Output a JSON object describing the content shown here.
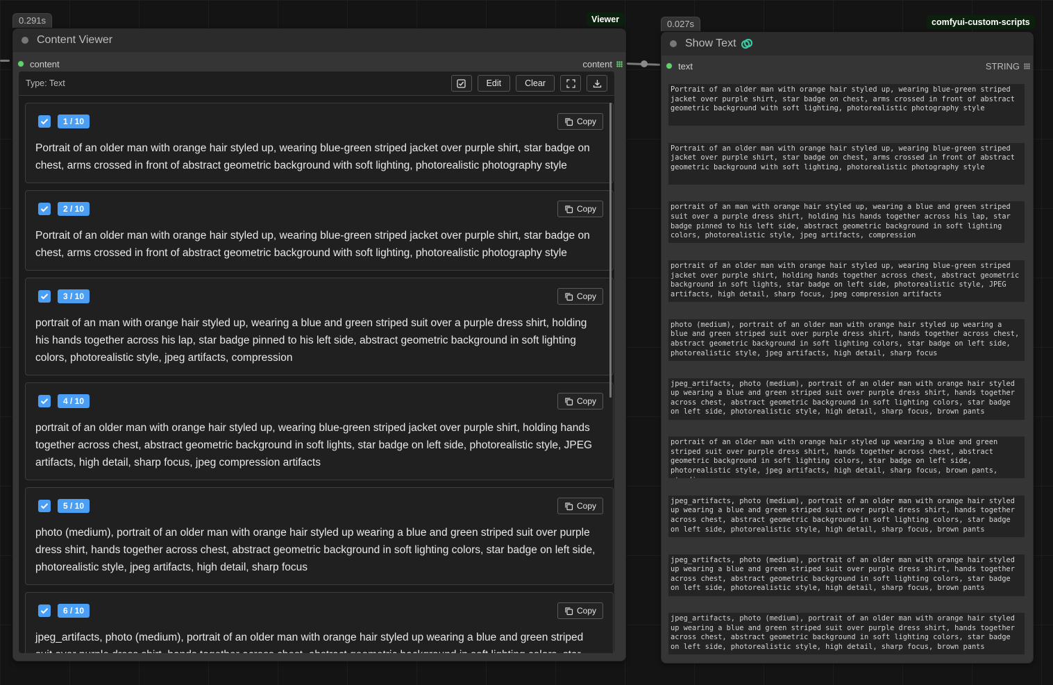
{
  "viewer": {
    "time": "0.291s",
    "tag": "Viewer",
    "title": "Content Viewer",
    "input_label": "content",
    "output_label": "content",
    "type_label": "Type: Text",
    "edit_label": "Edit",
    "clear_label": "Clear",
    "copy_label": "Copy",
    "items": [
      {
        "index": "1 / 10",
        "text": "Portrait of an older man with orange hair styled up, wearing blue-green striped jacket over purple shirt, star badge on chest, arms crossed in front of abstract geometric background with soft lighting, photorealistic photography style"
      },
      {
        "index": "2 / 10",
        "text": "Portrait of an older man with orange hair styled up, wearing blue-green striped jacket over purple shirt, star badge on chest, arms crossed in front of abstract geometric background with soft lighting, photorealistic photography style"
      },
      {
        "index": "3 / 10",
        "text": "portrait of an man with orange hair styled up, wearing a blue and green striped suit over a purple dress shirt, holding his hands together across his lap, star badge pinned to his left side, abstract geometric background in soft lighting colors, photorealistic style, jpeg artifacts, compression"
      },
      {
        "index": "4 / 10",
        "text": "portrait of an older man with orange hair styled up, wearing blue-green striped jacket over purple shirt, holding hands together across chest, abstract geometric background in soft lights, star badge on left side, photorealistic style, JPEG artifacts, high detail, sharp focus, jpeg compression artifacts"
      },
      {
        "index": "5 / 10",
        "text": "photo (medium), portrait of an older man with orange hair styled up wearing a blue and green striped suit over purple dress shirt, hands together across chest, abstract geometric background in soft lighting colors, star badge on left side, photorealistic style, jpeg artifacts, high detail, sharp focus"
      },
      {
        "index": "6 / 10",
        "text": "jpeg_artifacts, photo (medium), portrait of an older man with orange hair styled up wearing a blue and green striped suit over purple dress shirt, hands together across chest, abstract geometric background in soft lighting colors, star badge on left side, photorealistic style, high detail, sharp focus, brown pants"
      }
    ]
  },
  "showtext": {
    "time": "0.027s",
    "tag": "comfyui-custom-scripts",
    "title": "Show Text",
    "input_label": "text",
    "output_label": "STRING",
    "texts": [
      "Portrait of an older man with orange hair styled up, wearing blue-green striped jacket over purple shirt, star badge on chest, arms crossed in front of abstract geometric background with soft lighting, photorealistic photography style",
      "Portrait of an older man with orange hair styled up, wearing blue-green striped jacket over purple shirt, star badge on chest, arms crossed in front of abstract geometric background with soft lighting, photorealistic photography style",
      "portrait of an man with orange hair styled up, wearing a blue and green striped suit over a purple dress shirt, holding his hands together across his lap, star badge pinned to his left side, abstract geometric background in soft lighting colors, photorealistic style, jpeg artifacts, compression",
      "portrait of an older man with orange hair styled up, wearing blue-green striped jacket over purple shirt, holding hands together across chest, abstract geometric background in soft lights, star badge on left side, photorealistic style, JPEG artifacts, high detail, sharp focus, jpeg compression artifacts",
      "photo (medium), portrait of an older man with orange hair styled up wearing a blue and green striped suit over purple dress shirt, hands together across chest, abstract geometric background in soft lighting colors, star badge on left side, photorealistic style, jpeg artifacts, high detail, sharp focus",
      "jpeg_artifacts, photo (medium), portrait of an older man with orange hair styled up wearing a blue and green striped suit over purple dress shirt, hands together across chest, abstract geometric background in soft lighting colors, star badge on left side, photorealistic style, high detail, sharp focus, brown pants",
      "portrait of an older man with orange hair styled up wearing a blue and green striped suit over purple dress shirt, hands together across chest, abstract geometric background in soft lighting colors, star badge on left side, photorealistic style, jpeg artifacts, high detail, sharp focus, brown pants, standing pose",
      "jpeg_artifacts, photo (medium), portrait of an older man with orange hair styled up wearing a blue and green striped suit over purple dress shirt, hands together across chest, abstract geometric background in soft lighting colors, star badge on left side, photorealistic style, high detail, sharp focus, brown pants",
      "jpeg_artifacts, photo (medium), portrait of an older man with orange hair styled up wearing a blue and green striped suit over purple dress shirt, hands together across chest, abstract geometric background in soft lighting colors, star badge on left side, photorealistic style, high detail, sharp focus, brown pants",
      "jpeg_artifacts, photo (medium), portrait of an older man with orange hair styled up wearing a blue and green striped suit over purple dress shirt, hands together across chest, abstract geometric background in soft lighting colors, star badge on left side, photorealistic style, high detail, sharp focus, brown pants"
    ]
  },
  "colors": {
    "accent": "#4a9ff5",
    "slot_green": "#5fd36a",
    "tag_bg": "#0c200e"
  },
  "icons": {
    "checkall": "checkbox-icon",
    "fullscreen": "fullscreen-icon",
    "download": "download-icon",
    "copy": "copy-icon",
    "link": "link-icon"
  }
}
